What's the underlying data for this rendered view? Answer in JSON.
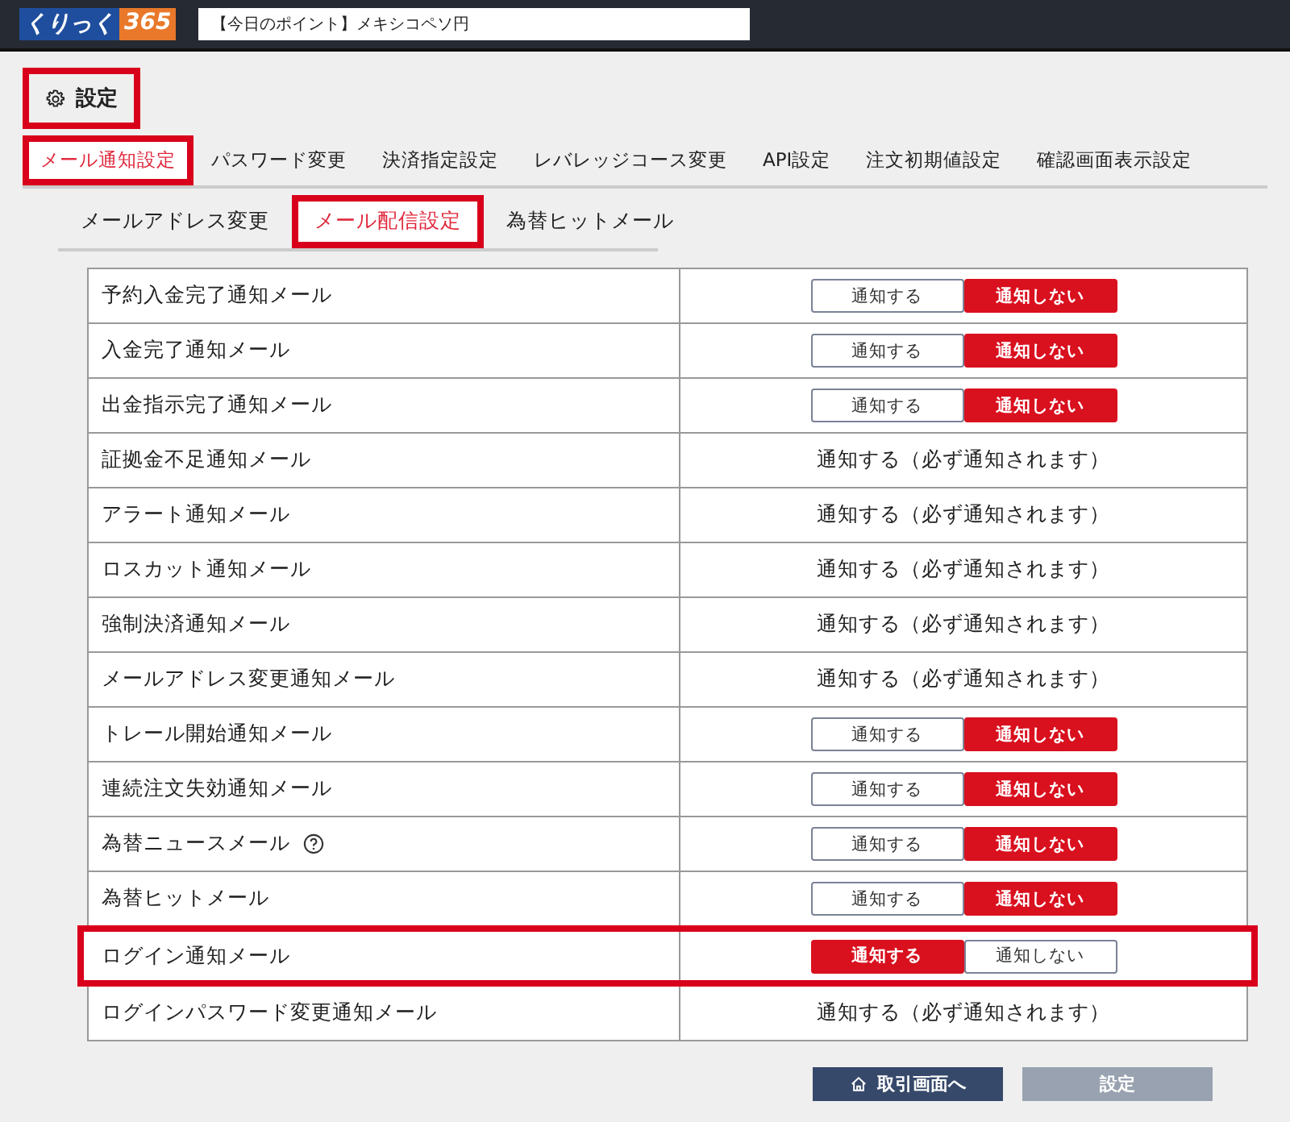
{
  "header": {
    "logo": {
      "main": "くりっく",
      "number": "365"
    },
    "ticker": "【今日のポイント】メキシコペソ円"
  },
  "page_title": {
    "label": "設定",
    "highlighted": true
  },
  "tabs": [
    {
      "label": "メール通知設定",
      "selected": true,
      "highlighted": true
    },
    {
      "label": "パスワード変更",
      "selected": false,
      "highlighted": false
    },
    {
      "label": "決済指定設定",
      "selected": false,
      "highlighted": false
    },
    {
      "label": "レバレッジコース変更",
      "selected": false,
      "highlighted": false
    },
    {
      "label": "API設定",
      "selected": false,
      "highlighted": false
    },
    {
      "label": "注文初期値設定",
      "selected": false,
      "highlighted": false
    },
    {
      "label": "確認画面表示設定",
      "selected": false,
      "highlighted": false
    }
  ],
  "subtabs": [
    {
      "label": "メールアドレス変更",
      "selected": false,
      "highlighted": false
    },
    {
      "label": "メール配信設定",
      "selected": true,
      "highlighted": true
    },
    {
      "label": "為替ヒットメール",
      "selected": false,
      "highlighted": false
    }
  ],
  "rows": [
    {
      "name": "予約入金完了通知メール",
      "kind": "toggle",
      "help": false,
      "highlighted": false,
      "options": [
        {
          "label": "通知する",
          "selected": false
        },
        {
          "label": "通知しない",
          "selected": true
        }
      ]
    },
    {
      "name": "入金完了通知メール",
      "kind": "toggle",
      "help": false,
      "highlighted": false,
      "options": [
        {
          "label": "通知する",
          "selected": false
        },
        {
          "label": "通知しない",
          "selected": true
        }
      ]
    },
    {
      "name": "出金指示完了通知メール",
      "kind": "toggle",
      "help": false,
      "highlighted": false,
      "options": [
        {
          "label": "通知する",
          "selected": false
        },
        {
          "label": "通知しない",
          "selected": true
        }
      ]
    },
    {
      "name": "証拠金不足通知メール",
      "kind": "fixed",
      "help": false,
      "highlighted": false,
      "value": "通知する（必ず通知されます）"
    },
    {
      "name": "アラート通知メール",
      "kind": "fixed",
      "help": false,
      "highlighted": false,
      "value": "通知する（必ず通知されます）"
    },
    {
      "name": "ロスカット通知メール",
      "kind": "fixed",
      "help": false,
      "highlighted": false,
      "value": "通知する（必ず通知されます）"
    },
    {
      "name": "強制決済通知メール",
      "kind": "fixed",
      "help": false,
      "highlighted": false,
      "value": "通知する（必ず通知されます）"
    },
    {
      "name": "メールアドレス変更通知メール",
      "kind": "fixed",
      "help": false,
      "highlighted": false,
      "value": "通知する（必ず通知されます）"
    },
    {
      "name": "トレール開始通知メール",
      "kind": "toggle",
      "help": false,
      "highlighted": false,
      "options": [
        {
          "label": "通知する",
          "selected": false
        },
        {
          "label": "通知しない",
          "selected": true
        }
      ]
    },
    {
      "name": "連続注文失効通知メール",
      "kind": "toggle",
      "help": false,
      "highlighted": false,
      "options": [
        {
          "label": "通知する",
          "selected": false
        },
        {
          "label": "通知しない",
          "selected": true
        }
      ]
    },
    {
      "name": "為替ニュースメール",
      "kind": "toggle",
      "help": true,
      "highlighted": false,
      "options": [
        {
          "label": "通知する",
          "selected": false
        },
        {
          "label": "通知しない",
          "selected": true
        }
      ]
    },
    {
      "name": "為替ヒットメール",
      "kind": "toggle",
      "help": false,
      "highlighted": false,
      "options": [
        {
          "label": "通知する",
          "selected": false
        },
        {
          "label": "通知しない",
          "selected": true
        }
      ]
    },
    {
      "name": "ログイン通知メール",
      "kind": "toggle",
      "help": false,
      "highlighted": true,
      "options": [
        {
          "label": "通知する",
          "selected": true
        },
        {
          "label": "通知しない",
          "selected": false
        }
      ]
    },
    {
      "name": "ログインパスワード変更通知メール",
      "kind": "fixed",
      "help": false,
      "highlighted": false,
      "value": "通知する（必ず通知されます）"
    }
  ],
  "footer_buttons": [
    {
      "label": "取引画面へ",
      "kind": "home",
      "disabled": false
    },
    {
      "label": "設定",
      "kind": "plain",
      "disabled": true
    }
  ]
}
